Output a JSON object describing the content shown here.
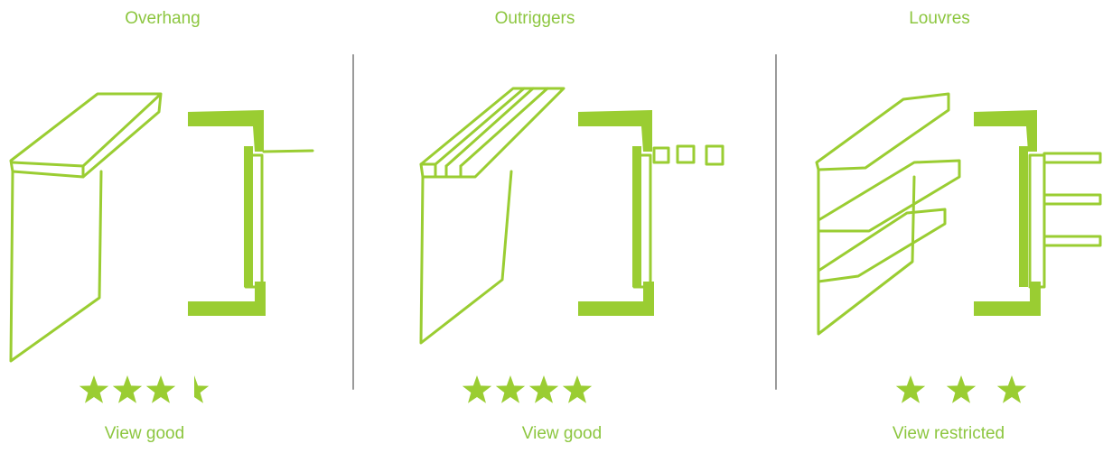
{
  "colors": {
    "accent": "#8cc63f",
    "divider": "#9a9a9a"
  },
  "panels": [
    {
      "title": "Overhang",
      "rating": 3.5,
      "caption": "View good"
    },
    {
      "title": "Outriggers",
      "rating": 4,
      "caption": "View good"
    },
    {
      "title": "Louvres",
      "rating": 3,
      "caption": "View restricted"
    }
  ]
}
